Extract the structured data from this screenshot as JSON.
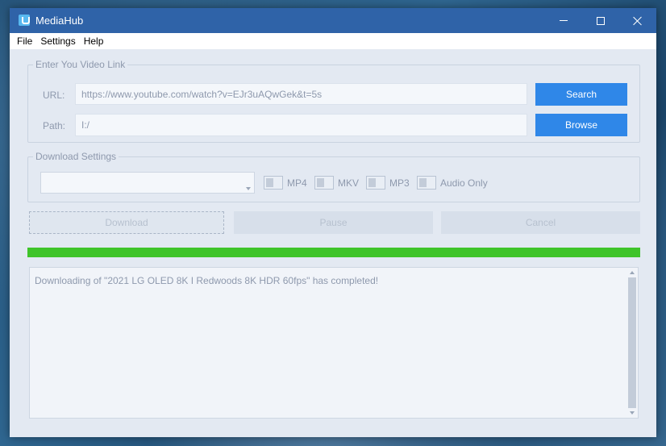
{
  "window": {
    "title": "MediaHub",
    "app_icon": "mediahub-logo-icon",
    "controls": {
      "minimize": "minimize-icon",
      "maximize": "maximize-icon",
      "close": "close-icon"
    }
  },
  "menu": [
    "File",
    "Settings",
    "Help"
  ],
  "link_group": {
    "legend": "Enter You Video Link",
    "url_label": "URL:",
    "url_value": "https://www.youtube.com/watch?v=EJr3uAQwGek&t=5s",
    "path_label": "Path:",
    "path_value": "I:/",
    "search_label": "Search",
    "browse_label": "Browse"
  },
  "download_settings": {
    "legend": "Download Settings",
    "format_select_value": "",
    "toggles": [
      {
        "label": "MP4",
        "on": false
      },
      {
        "label": "MKV",
        "on": false
      },
      {
        "label": "MP3",
        "on": false
      },
      {
        "label": "Audio Only",
        "on": false
      }
    ]
  },
  "actions": {
    "download": "Download",
    "pause": "Pause",
    "cancel": "Cancel"
  },
  "progress": {
    "value": 1.0
  },
  "log": {
    "text": "Downloading of \"2021 LG OLED 8K I  Redwoods 8K HDR 60fps\" has completed!"
  },
  "colors": {
    "accent": "#2f87e8",
    "progress": "#3fc42a",
    "titlebar": "#2f63a8",
    "panel": "#e3e9f2"
  }
}
